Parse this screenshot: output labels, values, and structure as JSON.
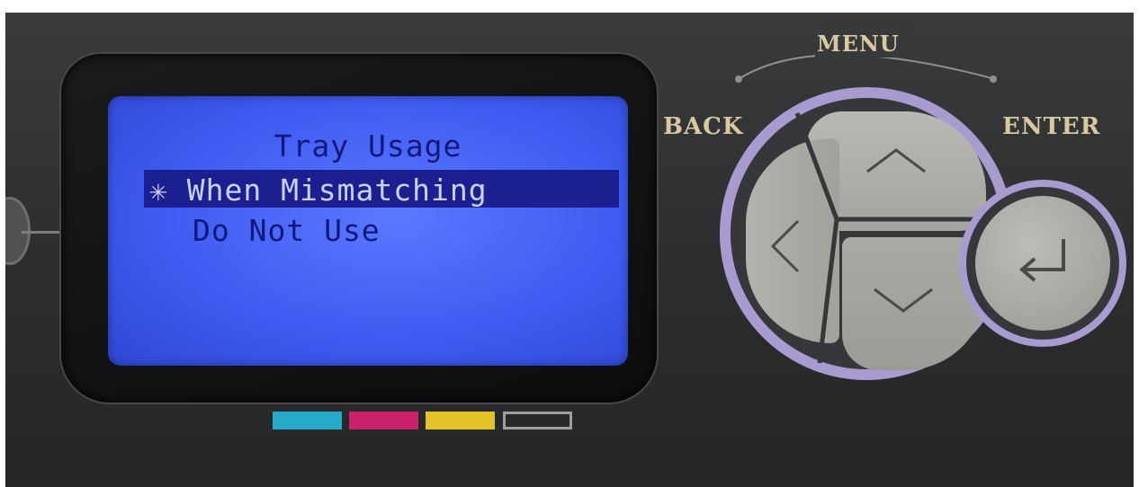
{
  "lcd": {
    "title": "Tray Usage",
    "selected_item": "✳ When Mismatching",
    "items": [
      "Do Not Use"
    ]
  },
  "labels": {
    "menu": "MENU",
    "back": "BACK",
    "enter": "ENTER"
  },
  "colors": {
    "lcd_background": "#4a66f5",
    "lcd_text": "#12187a",
    "highlight": "#1b1f8f",
    "ring": "#a99bd0",
    "label_text": "#d9c9a0",
    "cyan": "#27a9c9",
    "magenta": "#c9216a",
    "yellow": "#e2c226",
    "black_outline": "#9d9e9f"
  },
  "icons": {
    "up": "chevron-up-icon",
    "left": "chevron-left-icon",
    "down": "chevron-down-icon",
    "enter": "enter-return-icon"
  }
}
